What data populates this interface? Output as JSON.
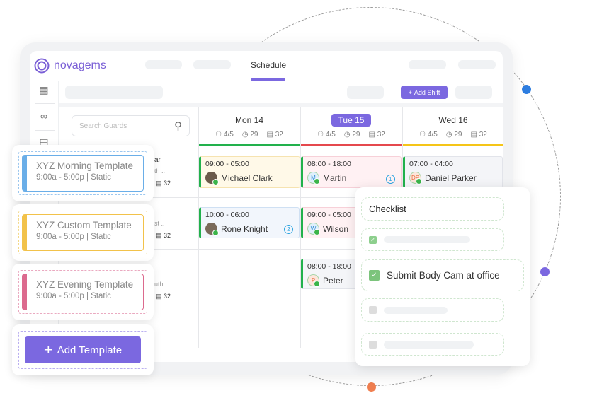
{
  "colors": {
    "accent": "#7b68e0",
    "green": "#22b14c",
    "red": "#e5484d",
    "yellow": "#f5c518",
    "blue_dot": "#2d7de0",
    "purple_dot": "#7b68e0",
    "orange_dot": "#f07f50"
  },
  "brand": {
    "name": "novagems"
  },
  "nav": {
    "active_tab": "Schedule"
  },
  "toolbar": {
    "add_shift": "Add Shift"
  },
  "search": {
    "placeholder": "Search Guards"
  },
  "days": [
    {
      "label": "Mon 14",
      "staff": "4/5",
      "hours": "29",
      "shifts": "32",
      "status_color": "#22b14c"
    },
    {
      "label": "Tue 15",
      "staff": "4/5",
      "hours": "29",
      "shifts": "32",
      "status_color": "#e5484d"
    },
    {
      "label": "Wed 16",
      "staff": "4/5",
      "hours": "29",
      "shifts": "32",
      "status_color": "#f5c518"
    }
  ],
  "guard_rows": [
    {
      "name_frag": "ar",
      "sub_frag": "th ..",
      "shifts": "32"
    },
    {
      "name_frag": "",
      "sub_frag": "st ..",
      "shifts": "32"
    },
    {
      "name_frag": "",
      "sub_frag": "uth ..",
      "shifts": "32"
    }
  ],
  "shifts": [
    {
      "time": "09:00 - 05:00",
      "name": "Michael Clark",
      "initials": ""
    },
    {
      "time": "08:00 - 18:00",
      "name": "Martin",
      "initials": "M",
      "badge": "1"
    },
    {
      "time": "07:00 - 04:00",
      "name": "Daniel Parker",
      "initials": "DP"
    },
    {
      "time": "10:00 - 06:00",
      "name": "Rone Knight",
      "initials": "",
      "badge": "2"
    },
    {
      "time": "09:00 - 05:00",
      "name": "Wilson",
      "initials": "W"
    },
    {
      "time": "08:00 - 18:00",
      "name": "Peter",
      "initials": "P"
    }
  ],
  "templates": [
    {
      "title": "XYZ Morning Template",
      "subtitle": "9:00a - 5:00p | Static",
      "color": "#6aaee8"
    },
    {
      "title": "XYZ Custom Template",
      "subtitle": "9:00a - 5:00p | Static",
      "color": "#f2c24a"
    },
    {
      "title": "XYZ Evening Template",
      "subtitle": "9:00a - 5:00p | Static",
      "color": "#dc6a8e"
    }
  ],
  "add_template": "Add Template",
  "checklist": {
    "title": "Checklist",
    "items": [
      {
        "label": "",
        "checked": true
      },
      {
        "label": "Submit Body Cam at office",
        "checked": true
      },
      {
        "label": "",
        "checked": false
      },
      {
        "label": "",
        "checked": false
      }
    ]
  }
}
